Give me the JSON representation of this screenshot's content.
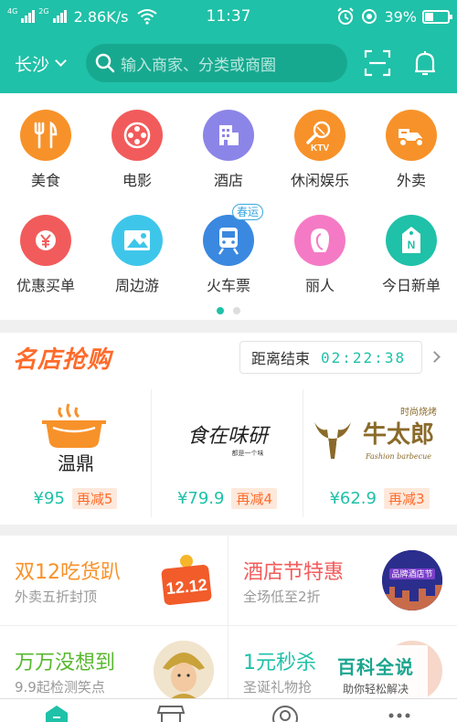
{
  "status_bar": {
    "network_tag_1": "4G",
    "network_tag_2": "2G",
    "speed": "2.86K/s",
    "time": "11:37",
    "battery": "39%",
    "battery_level": 0.39
  },
  "header": {
    "city": "长沙",
    "search_placeholder": "输入商家、分类或商圈",
    "accent_color": "#1fc1a8"
  },
  "categories": [
    {
      "label": "美食",
      "icon": "fork-knife-icon",
      "color": "#f7922a"
    },
    {
      "label": "电影",
      "icon": "film-reel-icon",
      "color": "#f25b5b"
    },
    {
      "label": "酒店",
      "icon": "building-icon",
      "color": "#8c85e8"
    },
    {
      "label": "休闲娱乐",
      "icon": "ktv-microphone-icon",
      "color": "#f7922a",
      "icon_text": "KTV"
    },
    {
      "label": "外卖",
      "icon": "delivery-scooter-icon",
      "color": "#f7922a"
    },
    {
      "label": "优惠买单",
      "icon": "yen-coin-icon",
      "color": "#f25b5b"
    },
    {
      "label": "周边游",
      "icon": "landscape-photo-icon",
      "color": "#3ec6ea"
    },
    {
      "label": "火车票",
      "icon": "train-icon",
      "color": "#3a88e0",
      "badge": "春运"
    },
    {
      "label": "丽人",
      "icon": "woman-profile-icon",
      "color": "#f57ac5"
    },
    {
      "label": "今日新单",
      "icon": "new-tag-icon",
      "color": "#1fc1a8",
      "icon_text": "N"
    }
  ],
  "page_indicator": {
    "pages": 2,
    "current": 1
  },
  "flash_sale": {
    "title": "名店抢购",
    "countdown_label": "距离结束",
    "countdown_time": "02:22:38",
    "shops": [
      {
        "logo_text": "温鼎",
        "price": "¥95",
        "discount": "再减5"
      },
      {
        "logo_text": "食在味研",
        "logo_sub": "都是一个味",
        "price": "¥79.9",
        "discount": "再减4"
      },
      {
        "logo_text": "牛太郎",
        "logo_top": "时尚烧烤",
        "logo_sub": "Fashion barbecue",
        "price": "¥62.9",
        "discount": "再减3"
      }
    ]
  },
  "promos": [
    {
      "title": "双12吃货趴",
      "subtitle": "外卖五折封顶",
      "color": "#f7922a",
      "image_text": "12.12"
    },
    {
      "title": "酒店节特惠",
      "subtitle": "全场低至2折",
      "color": "#f25b5b",
      "image_text": "品牌酒店节"
    },
    {
      "title": "万万没想到",
      "subtitle": "9.9起检测笑点",
      "color": "#58b82e"
    },
    {
      "title": "1元秒杀",
      "subtitle": "圣诞礼物抢",
      "color": "#1fc1a8"
    }
  ],
  "watermark": {
    "title": "百科全说",
    "subtitle": "助你轻松解决"
  },
  "bottom_nav": [
    {
      "icon": "home-icon"
    },
    {
      "icon": "store-icon"
    },
    {
      "icon": "discover-icon"
    },
    {
      "icon": "more-icon"
    }
  ]
}
